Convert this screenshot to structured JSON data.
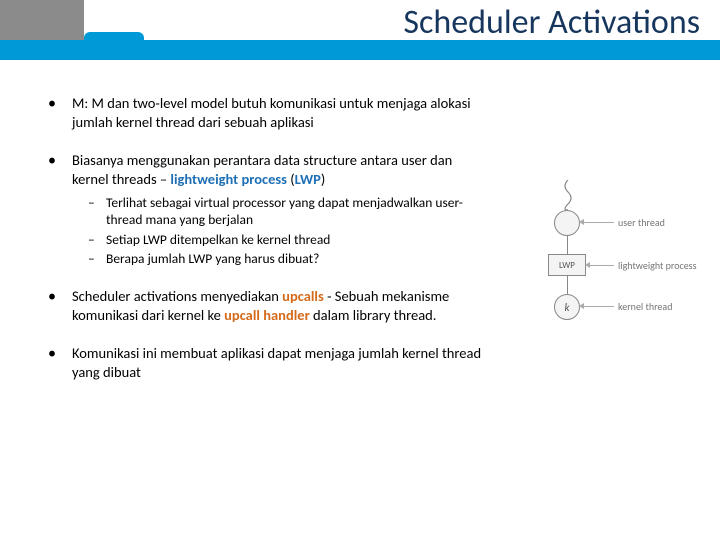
{
  "title": "Scheduler Activations",
  "bullets": {
    "b1": "M: M dan two-level model butuh komunikasi untuk menjaga alokasi jumlah kernel thread dari sebuah aplikasi",
    "b2_pre": "Biasanya menggunakan perantara data structure antara user dan kernel threads – ",
    "b2_lwp1": "lightweight process",
    "b2_paren_open": " (",
    "b2_lwp2": "LWP",
    "b2_paren_close": ")",
    "b2_sub1": "Terlihat sebagai virtual processor yang dapat menjadwalkan user-thread mana yang berjalan",
    "b2_sub2": "Setiap LWP ditempelkan ke kernel thread",
    "b2_sub3": "Berapa jumlah LWP yang harus dibuat?",
    "b3_pre": "Scheduler activations menyediakan ",
    "b3_up": "upcalls",
    "b3_mid": " - Sebuah mekanisme komunikasi dari kernel ke ",
    "b3_handler": "upcall handler",
    "b3_post": " dalam library thread.",
    "b4": "Komunikasi ini membuat aplikasi dapat menjaga jumlah kernel thread yang dibuat"
  },
  "diagram": {
    "lwp": "LWP",
    "k": "k",
    "label_user": "user thread",
    "label_lwp": "lightweight process",
    "label_kernel": "kernel thread"
  }
}
